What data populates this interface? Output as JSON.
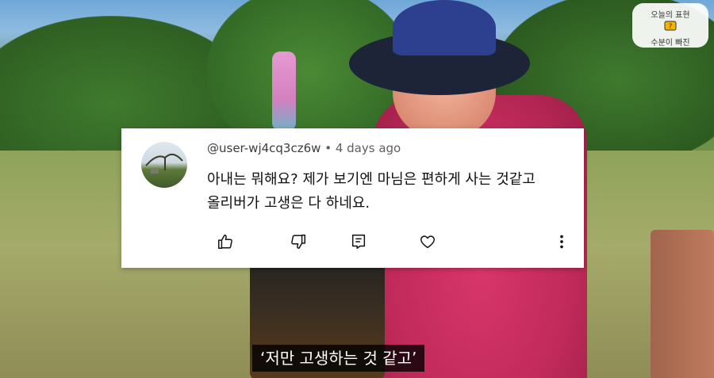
{
  "comment": {
    "username": "@user-wj4cq3cz6w",
    "separator": "•",
    "time": "4 days ago",
    "text_line1": "아내는 뭐해요? 제가 보기엔 마님은 편하게 사는 것같고",
    "text_line2": "올리버가 고생은 다 하네요.",
    "actions": [
      "like-icon",
      "dislike-icon",
      "reply-icon",
      "heart-icon",
      "more-vert-icon"
    ]
  },
  "badge": {
    "line1": "오늘의 표현",
    "line2": "수분이 빠진",
    "icon": "folder-icon"
  },
  "subtitle": {
    "text": "‘저만 고생하는 것 같고’"
  },
  "colors": {
    "shirt": "#c02a5a",
    "hat": "#2d3f8f",
    "card_bg": "#ffffff",
    "subtitle_bg": "#000000"
  }
}
